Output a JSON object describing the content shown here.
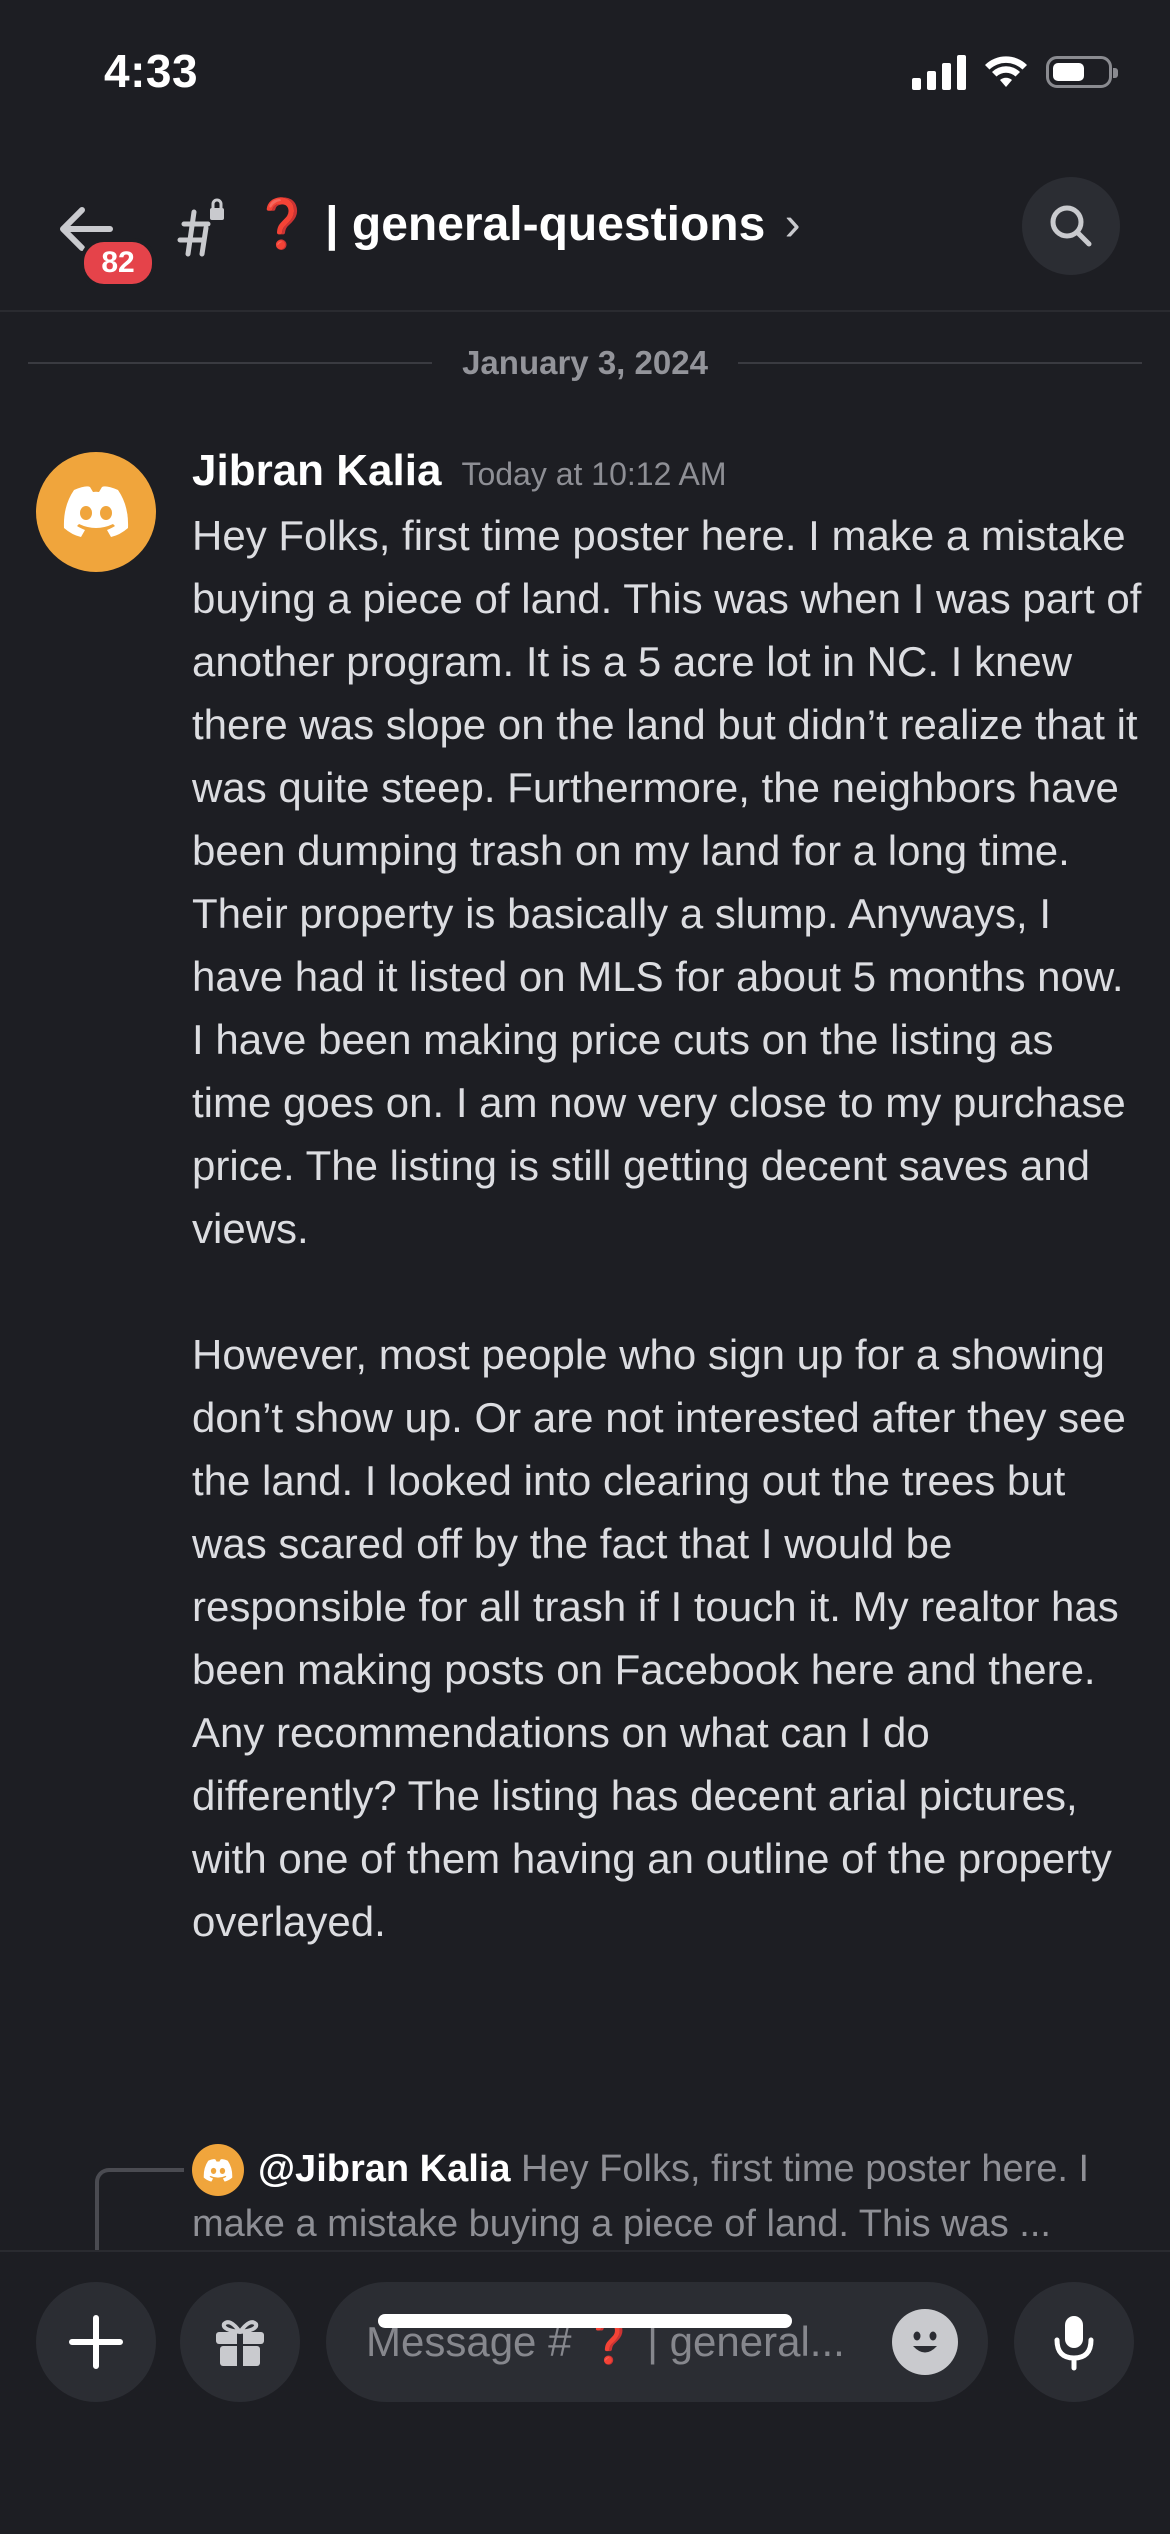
{
  "status_bar": {
    "time": "4:33",
    "battery_level": 0.6
  },
  "header": {
    "unread_badge": "82",
    "channel_emoji": "❓",
    "channel_name_rest": " | general-questions",
    "chevron": "›"
  },
  "date_divider": "January 3, 2024",
  "message": {
    "author": "Jibran Kalia",
    "timestamp": "Today at 10:12 AM",
    "paragraphs": [
      "Hey Folks, first time poster here. I make a mistake buying a piece of land. This was when I was part of another program. It is a 5 acre lot in NC. I knew there was slope on the land but didn’t realize that it was quite steep. Furthermore, the neighbors have been dumping trash on my land for a long time. Their property is basically a slump. Anyways, I have had it listed on MLS for about 5 months now. I have been making price cuts on the listing as time goes on. I am now very close to my purchase price. The listing is still getting decent saves and views.",
      "However, most people who sign up for a showing don’t show up. Or are not interested after they see the land. I looked into clearing out the trees but was scared off by the fact that I would be responsible for all trash if I touch it. My realtor has been making posts on Facebook here and there. Any recommendations on what can I do differently? The listing has decent arial pictures, with one of them having an outline of the property overlayed."
    ]
  },
  "reply_preview": {
    "author": "@Jibran Kalia",
    "text": "Hey Folks, first time poster here. I make a mistake buying a piece of land. This was ..."
  },
  "composer": {
    "placeholder_prefix": "Message # ",
    "placeholder_emoji": "❓",
    "placeholder_suffix": " | general..."
  },
  "icons": [
    "back-arrow-icon",
    "channel-hash-icon",
    "search-icon",
    "discord-logo-icon",
    "plus-icon",
    "gift-icon",
    "emoji-icon",
    "microphone-icon"
  ],
  "colors": {
    "background": "#1d1e23",
    "avatar": "#f0a53c",
    "badge": "#e5434a",
    "surface": "#2b2d33"
  }
}
